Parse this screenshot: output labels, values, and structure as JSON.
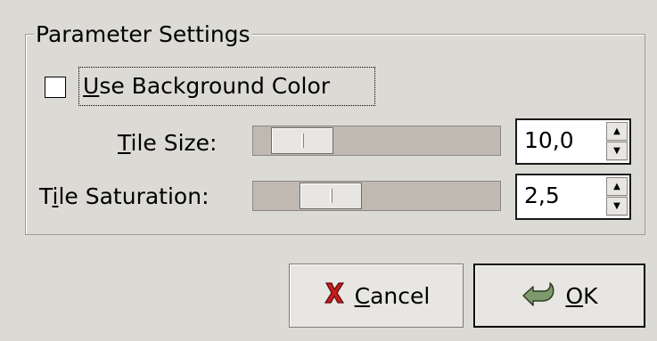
{
  "frame": {
    "title": "Parameter Settings"
  },
  "checkbox": {
    "label_prefix": "U",
    "label_rest": "se Background Color",
    "checked": false
  },
  "rows": [
    {
      "label_pre": "",
      "label_mnemonic": "T",
      "label_post": "ile Size:",
      "value": "10,0",
      "level": 0.08
    },
    {
      "label_pre": "T",
      "label_mnemonic": "i",
      "label_post": "le Saturation:",
      "value": "2,5",
      "level": 0.24
    }
  ],
  "buttons": {
    "cancel_mnemonic": "C",
    "cancel_rest": "ancel",
    "ok_mnemonic": "O",
    "ok_rest": "K"
  },
  "colors": {
    "background": "#dcdad5",
    "trough": "#bfb9b1",
    "cancel_icon": "#c41e1e",
    "ok_icon": "#7d9a6a"
  },
  "icons": {
    "cancel": "red-x-icon",
    "ok": "green-hand-icon",
    "spin_up": "up-arrow-icon",
    "spin_down": "down-arrow-icon"
  }
}
